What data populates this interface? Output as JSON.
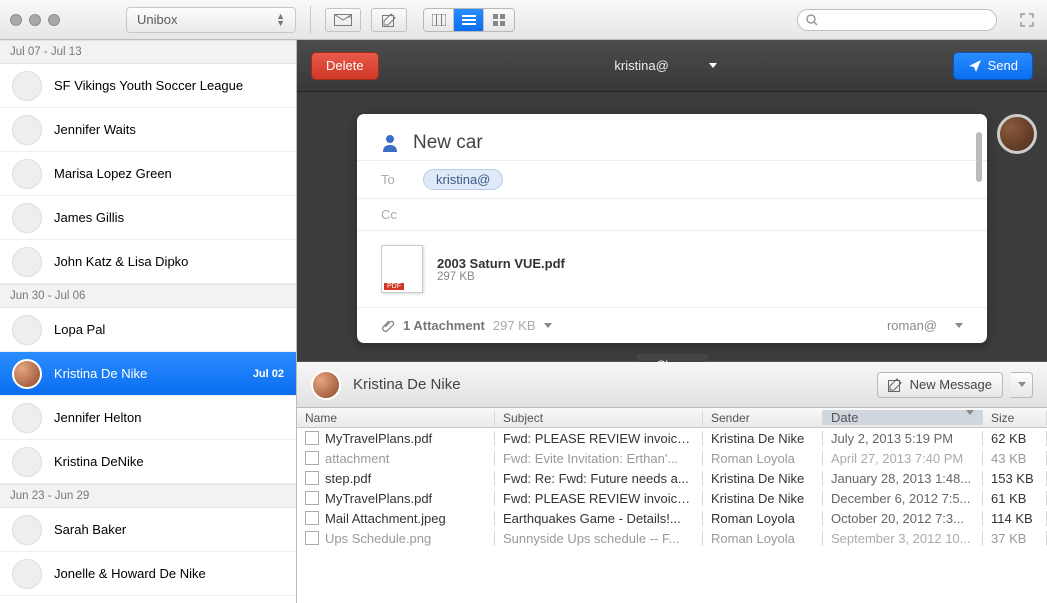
{
  "titlebar": {
    "app_name": "Unibox"
  },
  "sidebar": {
    "groups": [
      {
        "range": "Jul 07 - Jul 13",
        "items": [
          {
            "name": "SF Vikings Youth Soccer League"
          },
          {
            "name": "Jennifer Waits"
          },
          {
            "name": "Marisa Lopez Green"
          },
          {
            "name": "James Gillis"
          },
          {
            "name": "John Katz & Lisa Dipko"
          }
        ]
      },
      {
        "range": "Jun 30 - Jul 06",
        "items": [
          {
            "name": "Lopa Pal"
          },
          {
            "name": "Kristina De Nike",
            "selected": true,
            "date": "Jul 02"
          },
          {
            "name": "Jennifer Helton"
          },
          {
            "name": "Kristina DeNike"
          }
        ]
      },
      {
        "range": "Jun 23 - Jun 29",
        "items": [
          {
            "name": "Sarah Baker"
          },
          {
            "name": "Jonelle & Howard De Nike"
          }
        ]
      }
    ]
  },
  "compose": {
    "delete_label": "Delete",
    "send_label": "Send",
    "header_recipient": "kristina@",
    "subject": "New car",
    "to_label": "To",
    "cc_label": "Cc",
    "to_token": "kristina@",
    "attachment_name": "2003 Saturn VUE.pdf",
    "attachment_size": "297 KB",
    "footer_count": "1 Attachment",
    "footer_size": "297 KB",
    "from_account": "roman@"
  },
  "lower": {
    "close_label": "Close",
    "person_name": "Kristina De Nike",
    "new_message_label": "New Message",
    "columns": {
      "name": "Name",
      "subject": "Subject",
      "sender": "Sender",
      "date": "Date",
      "size": "Size"
    },
    "rows": [
      {
        "name": "MyTravelPlans.pdf",
        "subject": "Fwd: PLEASE REVIEW invoice...",
        "sender": "Kristina De Nike",
        "date": "July 2, 2013 5:19 PM",
        "size": "62 KB"
      },
      {
        "name": "attachment",
        "subject": "Fwd: Evite Invitation: Erthan'...",
        "sender": "Roman Loyola",
        "date": "April 27, 2013 7:40 PM",
        "size": "43 KB",
        "muted": true
      },
      {
        "name": "step.pdf",
        "subject": "Fwd: Re: Fwd: Future needs a...",
        "sender": "Kristina De Nike",
        "date": "January 28, 2013 1:48...",
        "size": "153 KB"
      },
      {
        "name": "MyTravelPlans.pdf",
        "subject": "Fwd: PLEASE REVIEW invoice...",
        "sender": "Kristina De Nike",
        "date": "December 6, 2012 7:5...",
        "size": "61 KB"
      },
      {
        "name": "Mail Attachment.jpeg",
        "subject": "Earthquakes Game - Details!...",
        "sender": "Roman Loyola",
        "date": "October 20, 2012 7:3...",
        "size": "114 KB"
      },
      {
        "name": "Ups Schedule.png",
        "subject": "Sunnyside Ups schedule -- F...",
        "sender": "Roman Loyola",
        "date": "September 3, 2012 10...",
        "size": "37 KB",
        "muted": true
      }
    ]
  }
}
